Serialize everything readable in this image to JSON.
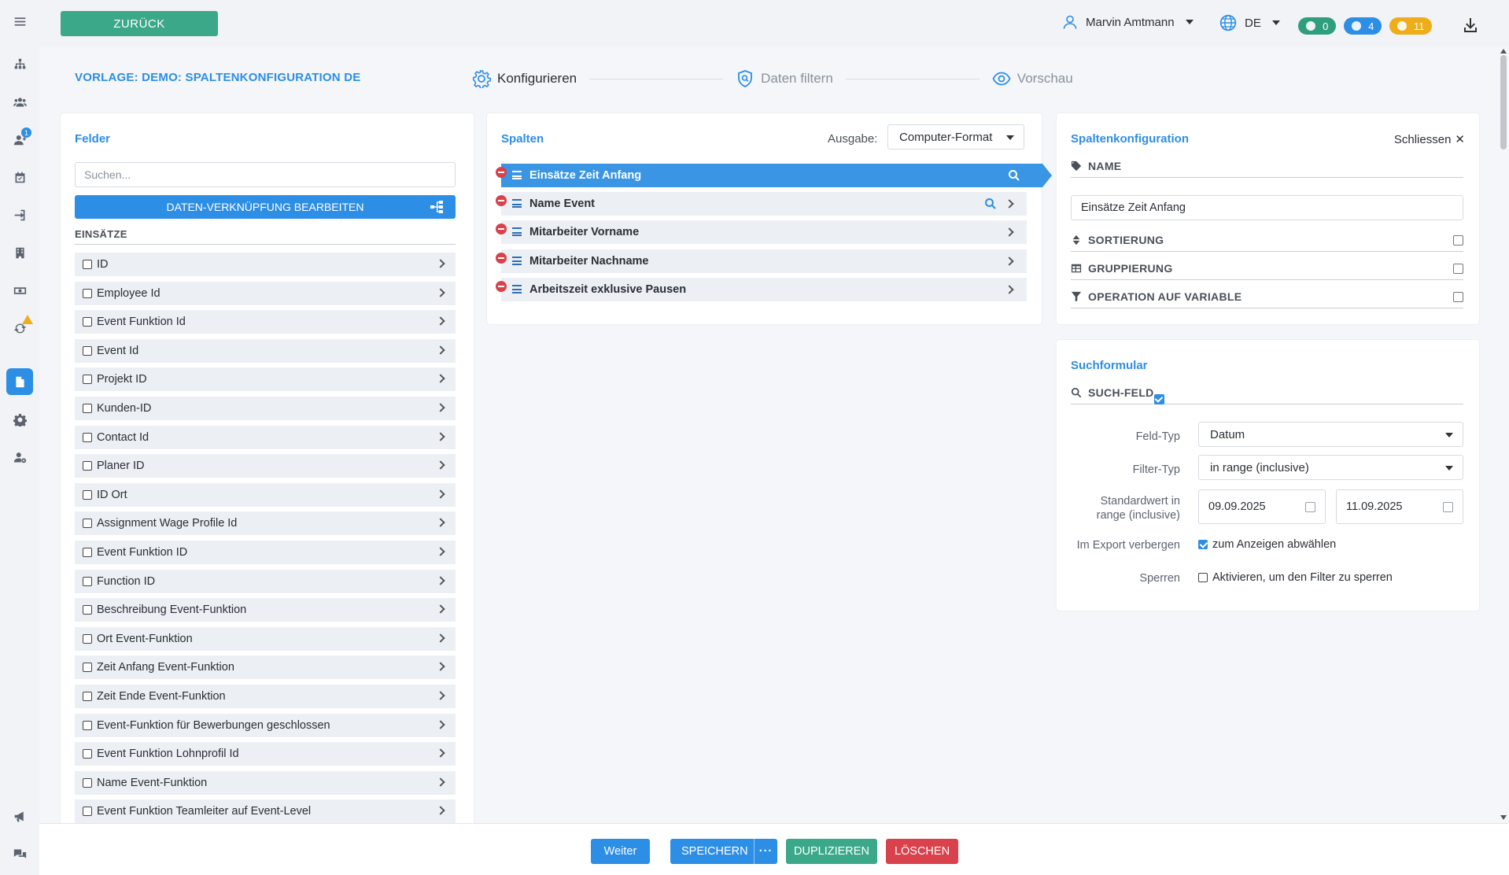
{
  "topbar": {
    "back_label": "ZURÜCK",
    "user_name": "Marvin Amtmann",
    "language": "DE",
    "badges": {
      "messages": "0",
      "notifications": "4",
      "alerts": "11"
    }
  },
  "sidebar": {
    "badge_count": "1"
  },
  "page": {
    "template_title": "VORLAGE: DEMO: SPALTENKONFIGURATION DE",
    "steps": [
      {
        "label": "Konfigurieren"
      },
      {
        "label": "Daten filtern"
      },
      {
        "label": "Vorschau"
      }
    ]
  },
  "felder": {
    "title": "Felder",
    "search_placeholder": "Suchen...",
    "link_button": "DATEN-VERKNÜPFUNG BEARBEITEN",
    "group_label": "EINSÄTZE",
    "items": [
      "ID",
      "Employee Id",
      "Event Funktion Id",
      "Event Id",
      "Projekt ID",
      "Kunden-ID",
      "Contact Id",
      "Planer ID",
      "ID Ort",
      "Assignment Wage Profile Id",
      "Event Funktion ID",
      "Function ID",
      "Beschreibung Event-Funktion",
      "Ort Event-Funktion",
      "Zeit Anfang Event-Funktion",
      "Zeit Ende Event-Funktion",
      "Event-Funktion für Bewerbungen geschlossen",
      "Event Funktion Lohnprofil Id",
      "Name Event-Funktion",
      "Event Funktion Teamleiter auf Event-Level"
    ]
  },
  "spalten": {
    "title": "Spalten",
    "ausgabe_label": "Ausgabe:",
    "ausgabe_value": "Computer-Format",
    "columns": [
      "Einsätze Zeit Anfang",
      "Name Event",
      "Mitarbeiter Vorname",
      "Mitarbeiter Nachname",
      "Arbeitszeit exklusive Pausen"
    ]
  },
  "konfig": {
    "title": "Spaltenkonfiguration",
    "close_label": "Schliessen",
    "name_label": "NAME",
    "name_value": "Einsätze Zeit Anfang",
    "sortierung_label": "SORTIERUNG",
    "gruppierung_label": "GRUPPIERUNG",
    "operation_label": "OPERATION AUF VARIABLE"
  },
  "such": {
    "title": "Suchformular",
    "suchfeld_label": "SUCH-FELD",
    "feldtyp_label": "Feld-Typ",
    "feldtyp_value": "Datum",
    "filtertyp_label": "Filter-Typ",
    "filtertyp_value": "in range (inclusive)",
    "standard_label_1": "Standardwert in",
    "standard_label_2": "range (inclusive)",
    "date_from": "09.09.2025",
    "date_to": "11.09.2025",
    "export_label": "Im Export verbergen",
    "export_check": "zum Anzeigen abwählen",
    "sperren_label": "Sperren",
    "sperren_check": "Aktivieren, um den Filter zu sperren"
  },
  "footer": {
    "weiter": "Weiter",
    "speichern": "SPEICHERN",
    "more": "···",
    "duplizieren": "DUPLIZIEREN",
    "loeschen": "LÖSCHEN"
  },
  "colors": {
    "primary": "#2d8ee6",
    "success": "#3aa889",
    "danger": "#d9414c",
    "warning": "#f0ad1a",
    "badge_green": "#2f9e7c"
  }
}
